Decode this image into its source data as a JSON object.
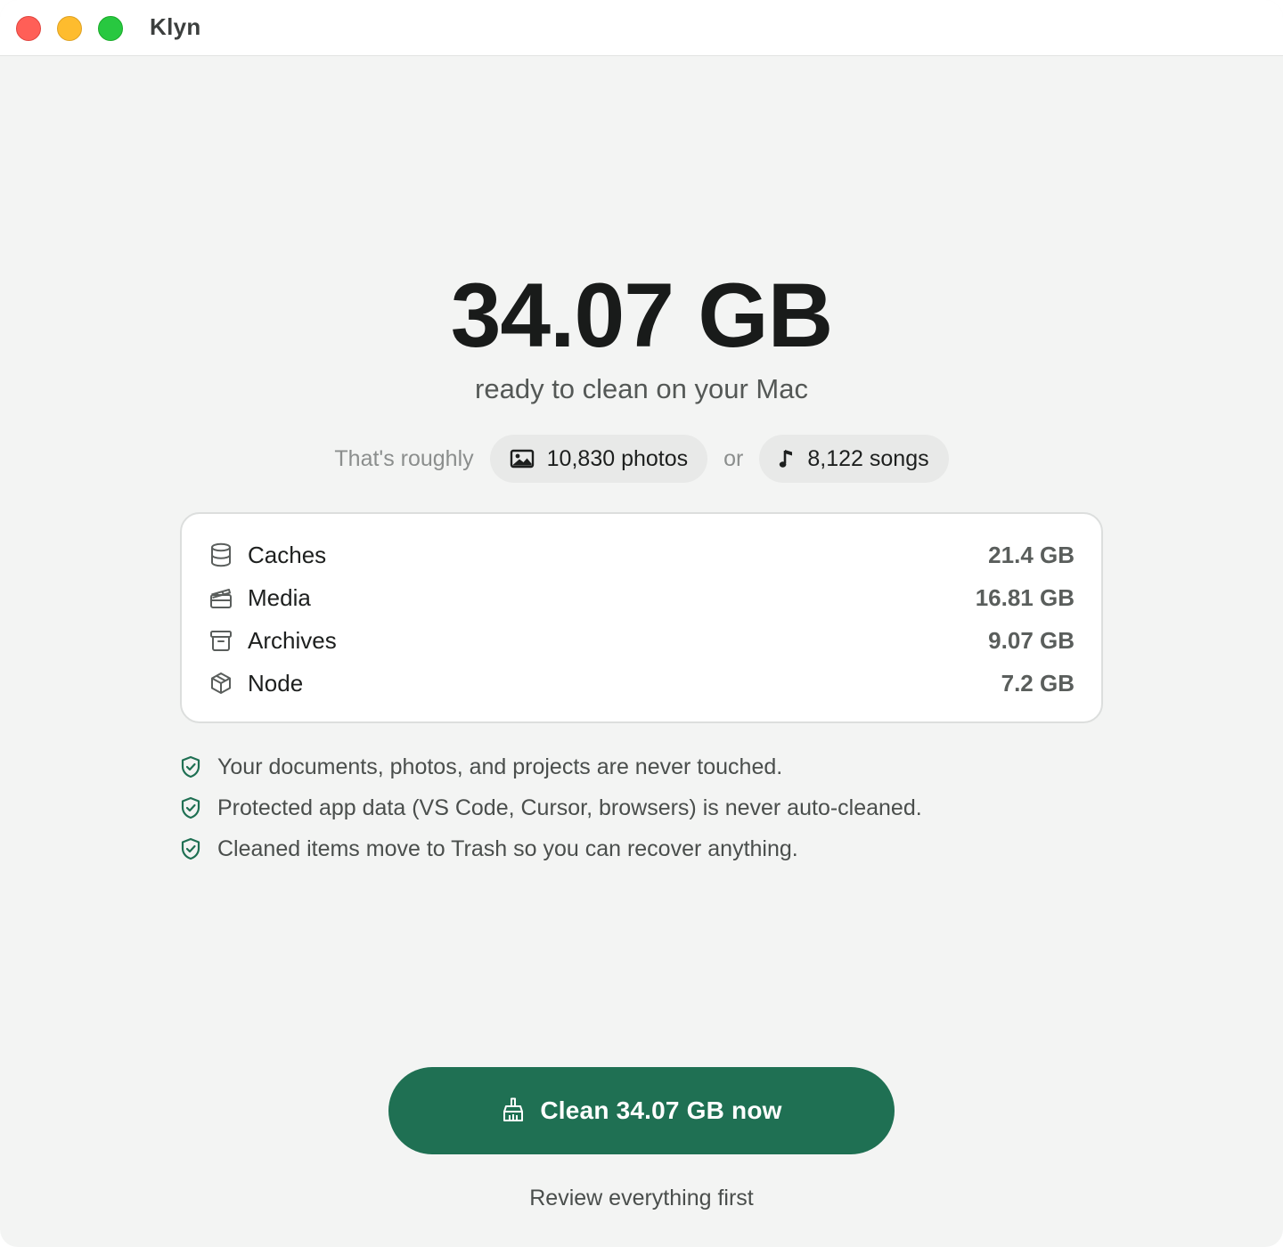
{
  "window": {
    "title": "Klyn"
  },
  "summary": {
    "total_size": "34.07 GB",
    "subtitle": "ready to clean on your Mac"
  },
  "comparison": {
    "lead": "That's roughly",
    "photos": {
      "label": "10,830 photos",
      "icon": "image-icon"
    },
    "separator": "or",
    "songs": {
      "label": "8,122 songs",
      "icon": "music-note-icon"
    }
  },
  "breakdown": {
    "items": [
      {
        "icon": "database-icon",
        "name": "Caches",
        "size": "21.4 GB"
      },
      {
        "icon": "clapperboard-icon",
        "name": "Media",
        "size": "16.81 GB"
      },
      {
        "icon": "archive-icon",
        "name": "Archives",
        "size": "9.07 GB"
      },
      {
        "icon": "package-icon",
        "name": "Node",
        "size": "7.2 GB"
      }
    ]
  },
  "assurances": [
    {
      "icon": "shield-check-icon",
      "text": "Your documents, photos, and projects are never touched."
    },
    {
      "icon": "shield-check-icon",
      "text": "Protected app data (VS Code, Cursor, browsers) is never auto-cleaned."
    },
    {
      "icon": "shield-check-icon",
      "text": "Cleaned items move to Trash so you can recover anything."
    }
  ],
  "actions": {
    "primary_label": "Clean 34.07 GB now",
    "primary_icon": "broom-icon",
    "secondary_label": "Review everything first"
  },
  "colors": {
    "accent": "#1f7053",
    "background": "#f3f4f3",
    "close": "#ff5f57",
    "minimize": "#febc2e",
    "zoom": "#28c840"
  }
}
